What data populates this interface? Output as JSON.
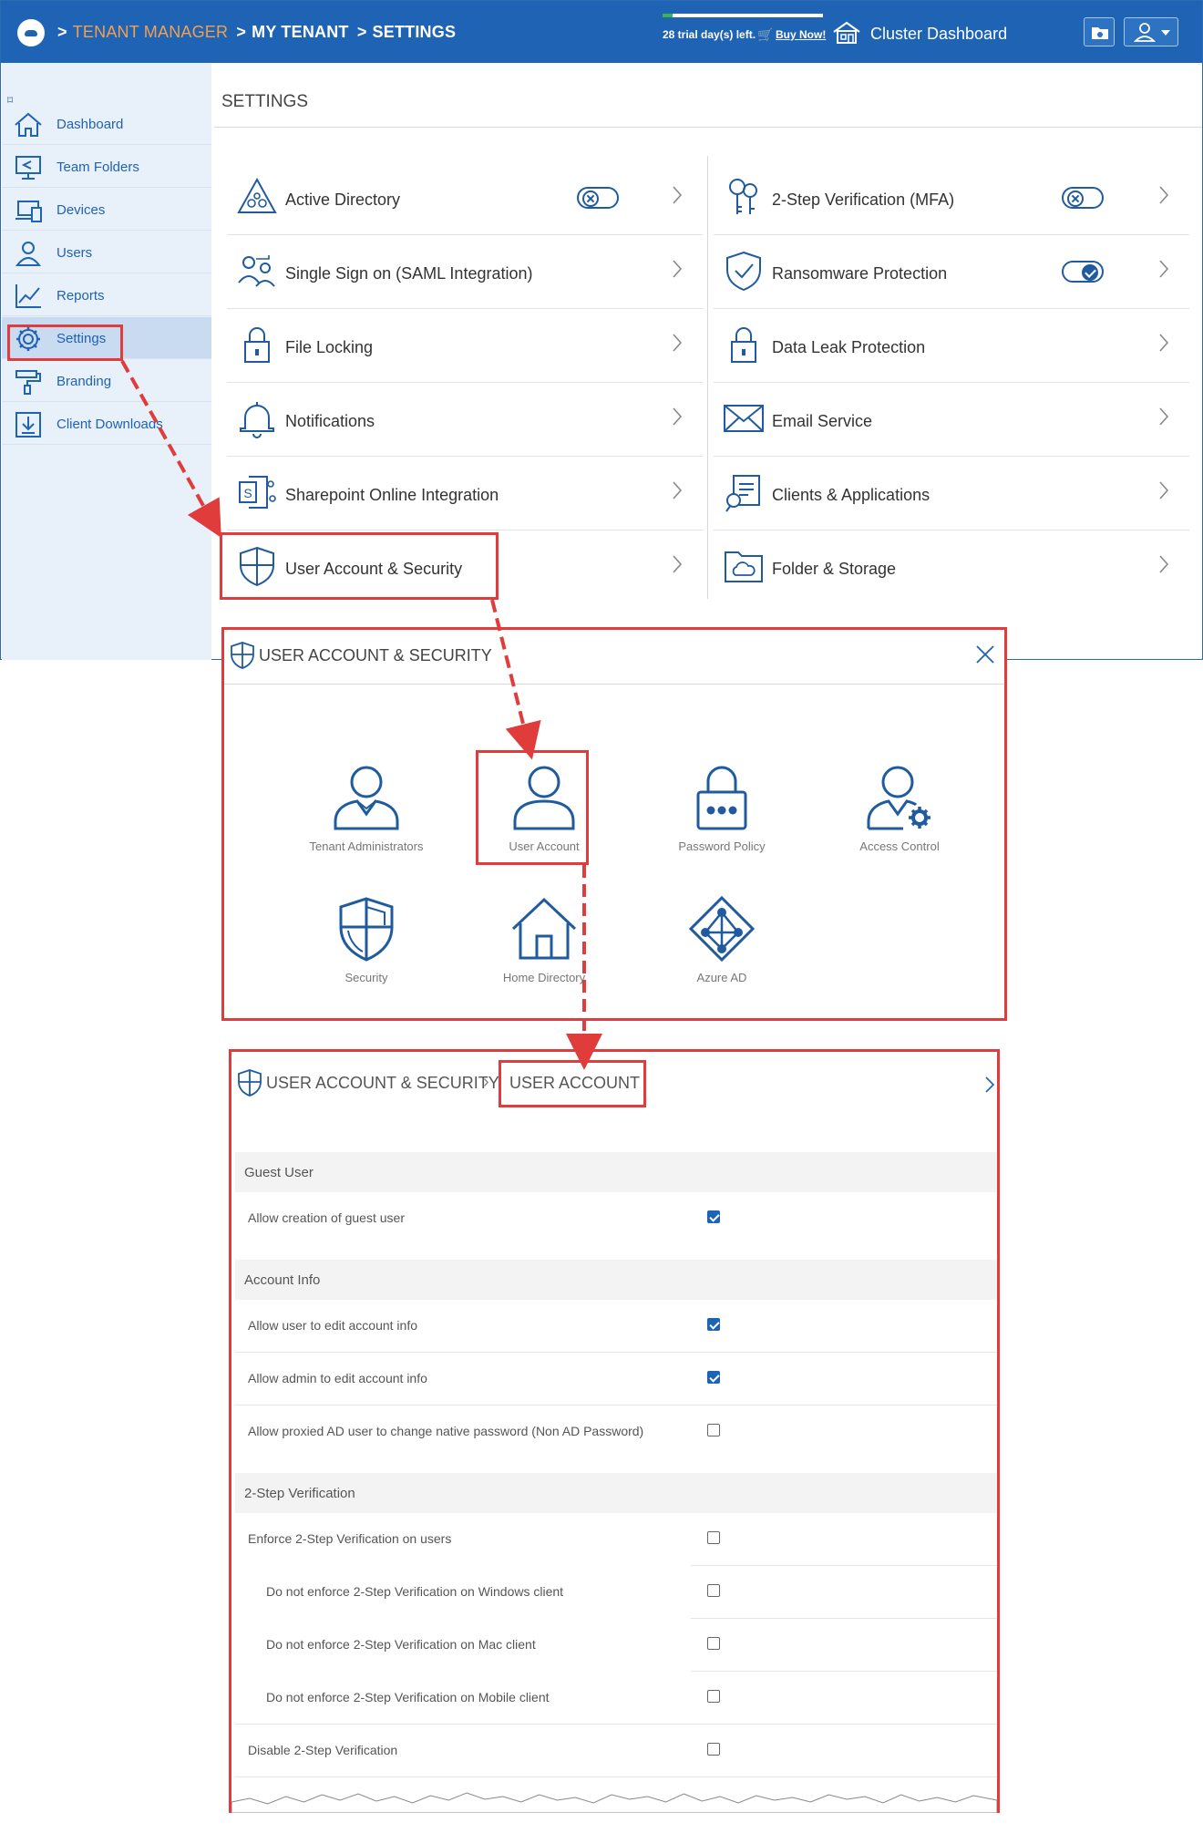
{
  "topbar": {
    "breadcrumb": {
      "separator": ">",
      "tenant_manager": "TENANT MANAGER",
      "my_tenant": "MY TENANT",
      "settings": "SETTINGS"
    },
    "trial_text": "28 trial day(s) left.",
    "trial_progress": 0.06,
    "buy_now": "Buy Now!",
    "cluster_dashboard": "Cluster Dashboard"
  },
  "sidebar": {
    "collapse_glyph": "⌑",
    "items": [
      {
        "label": "Dashboard",
        "icon": "home-icon"
      },
      {
        "label": "Team Folders",
        "icon": "team-folders-icon"
      },
      {
        "label": "Devices",
        "icon": "devices-icon"
      },
      {
        "label": "Users",
        "icon": "users-icon"
      },
      {
        "label": "Reports",
        "icon": "reports-icon"
      },
      {
        "label": "Settings",
        "icon": "gear-icon",
        "active": true
      },
      {
        "label": "Branding",
        "icon": "paint-roller-icon"
      },
      {
        "label": "Client Downloads",
        "icon": "download-icon"
      }
    ]
  },
  "settings": {
    "title": "SETTINGS",
    "left": [
      {
        "label": "Active Directory",
        "toggle": "off"
      },
      {
        "label": "Single Sign on (SAML Integration)"
      },
      {
        "label": "File Locking"
      },
      {
        "label": "Notifications"
      },
      {
        "label": "Sharepoint Online Integration"
      },
      {
        "label": "User Account & Security"
      }
    ],
    "right": [
      {
        "label": "2-Step Verification (MFA)",
        "toggle": "off"
      },
      {
        "label": "Ransomware Protection",
        "toggle": "on"
      },
      {
        "label": "Data Leak Protection"
      },
      {
        "label": "Email Service"
      },
      {
        "label": "Clients & Applications"
      },
      {
        "label": "Folder & Storage"
      }
    ]
  },
  "security_dialog": {
    "title": "USER ACCOUNT & SECURITY",
    "tiles": [
      "Tenant Administrators",
      "User Account",
      "Password Policy",
      "Access Control",
      "Security",
      "Home Directory",
      "Azure AD"
    ]
  },
  "user_account_panel": {
    "crumb_parent": "USER ACCOUNT & SECURITY",
    "crumb_separator": "›",
    "crumb_current": "USER ACCOUNT",
    "sections": {
      "guest": "Guest User",
      "account": "Account Info",
      "twostep": "2-Step Verification"
    },
    "options": {
      "allow_guest": {
        "label": "Allow creation of guest user",
        "checked": true
      },
      "user_edit": {
        "label": "Allow user to edit account info",
        "checked": true
      },
      "admin_edit": {
        "label": "Allow admin to edit account info",
        "checked": true
      },
      "proxied_ad": {
        "label": "Allow proxied AD user to change native password (Non AD Password)",
        "checked": false
      },
      "enforce_2sv": {
        "label": "Enforce 2-Step Verification on users",
        "checked": false
      },
      "no_windows": {
        "label": "Do not enforce 2-Step Verification on Windows client",
        "checked": false
      },
      "no_mac": {
        "label": "Do not enforce 2-Step Verification on Mac client",
        "checked": false
      },
      "no_mobile": {
        "label": "Do not enforce 2-Step Verification on Mobile client",
        "checked": false
      },
      "disable_2sv": {
        "label": "Disable 2-Step Verification",
        "checked": false
      }
    }
  },
  "colors": {
    "brand_blue": "#1f63b4",
    "accent_orange": "#f0a050",
    "highlight_red": "#e03c3c"
  }
}
